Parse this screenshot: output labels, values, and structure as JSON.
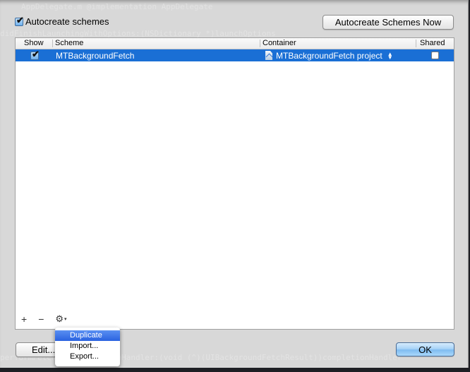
{
  "background_code_ghost": [
    "AppDelegate.m  @implementation AppDelegate",
    "didFinishLaunchingWithOptions:(NSDictionary *)launchOptions",
    "performFetchWithCompletionHandler:(void (^)(UIBackgroundFetchResult))completionHandler"
  ],
  "autocreate": {
    "label": "Autocreate schemes",
    "checked": true
  },
  "buttons": {
    "autocreate_now": "Autocreate Schemes Now",
    "edit": "Edit...",
    "ok": "OK"
  },
  "table": {
    "columns": [
      "Show",
      "Scheme",
      "Container",
      "Shared"
    ],
    "rows": [
      {
        "show": true,
        "scheme": "MTBackgroundFetch",
        "container": "MTBackgroundFetch project",
        "shared": false,
        "selected": true
      }
    ]
  },
  "toolbar": {
    "add": "+",
    "remove": "−",
    "gear": "⚙",
    "caret": "▾"
  },
  "menu": {
    "items": [
      {
        "label": "Duplicate",
        "highlighted": true
      },
      {
        "label": "Import..."
      },
      {
        "label": "Export..."
      }
    ]
  },
  "colors": {
    "selection": "#1a6fd5",
    "menu_highlight": "#2a62e0"
  }
}
